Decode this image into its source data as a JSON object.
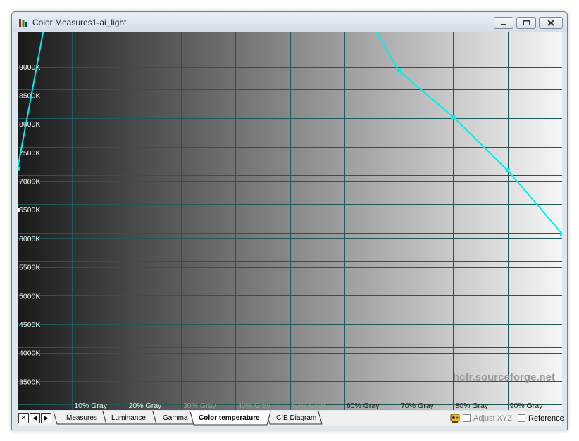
{
  "window": {
    "title": "Color Measures1-ai_light"
  },
  "chart_data": {
    "type": "line",
    "title": "",
    "xlabel": "",
    "ylabel": "",
    "ylim": [
      3000,
      9600
    ],
    "xlim": [
      0,
      100
    ],
    "y_ticks": [
      {
        "value": 9000,
        "label": "9000K"
      },
      {
        "value": 8500,
        "label": "8500K"
      },
      {
        "value": 8000,
        "label": "8000K"
      },
      {
        "value": 7500,
        "label": "7500K"
      },
      {
        "value": 7000,
        "label": "7000K"
      },
      {
        "value": 6500,
        "label": "6500K"
      },
      {
        "value": 6000,
        "label": "6000K"
      },
      {
        "value": 5500,
        "label": "5500K"
      },
      {
        "value": 5000,
        "label": "5000K"
      },
      {
        "value": 4500,
        "label": "4500K"
      },
      {
        "value": 4000,
        "label": "4000K"
      },
      {
        "value": 3500,
        "label": "3500K"
      }
    ],
    "x_ticks": [
      {
        "value": 10,
        "label": "10% Gray"
      },
      {
        "value": 20,
        "label": "20% Gray"
      },
      {
        "value": 30,
        "label": "30% Gray"
      },
      {
        "value": 40,
        "label": "40% Gray"
      },
      {
        "value": 50,
        "label": "50% Gray"
      },
      {
        "value": 60,
        "label": "60% Gray"
      },
      {
        "value": 70,
        "label": "70% Gray"
      },
      {
        "value": 80,
        "label": "80% Gray"
      },
      {
        "value": 90,
        "label": "90% Gray"
      }
    ],
    "reference_line": 6500,
    "series": [
      {
        "color": "#00f0f0",
        "points": [
          {
            "x": 0,
            "y": 7220
          },
          {
            "x": 10,
            "y": 12300
          },
          {
            "x": 60,
            "y": 10600
          },
          {
            "x": 70,
            "y": 8930
          },
          {
            "x": 80,
            "y": 8120
          },
          {
            "x": 90,
            "y": 7190
          },
          {
            "x": 100,
            "y": 6080
          }
        ]
      }
    ],
    "grid": true,
    "watermark": "hcfr.sourceforge.net",
    "background": "grayscale-gradient"
  },
  "bottombar": {
    "nav": [
      "✕",
      "◀",
      "▶"
    ],
    "tabs": [
      {
        "label": "Measures",
        "active": false
      },
      {
        "label": "Luminance",
        "active": false
      },
      {
        "label": "Gamma",
        "active": false
      },
      {
        "label": "Color temperature",
        "active": true
      },
      {
        "label": "CIE Diagram",
        "active": false
      }
    ],
    "adjust_xyz_label": "Adjust XYZ",
    "reference_label": "Reference"
  },
  "colors": {
    "grid": "#1f5a5a",
    "series": "#00f0f0",
    "window_frame": "#dfe6ee"
  }
}
